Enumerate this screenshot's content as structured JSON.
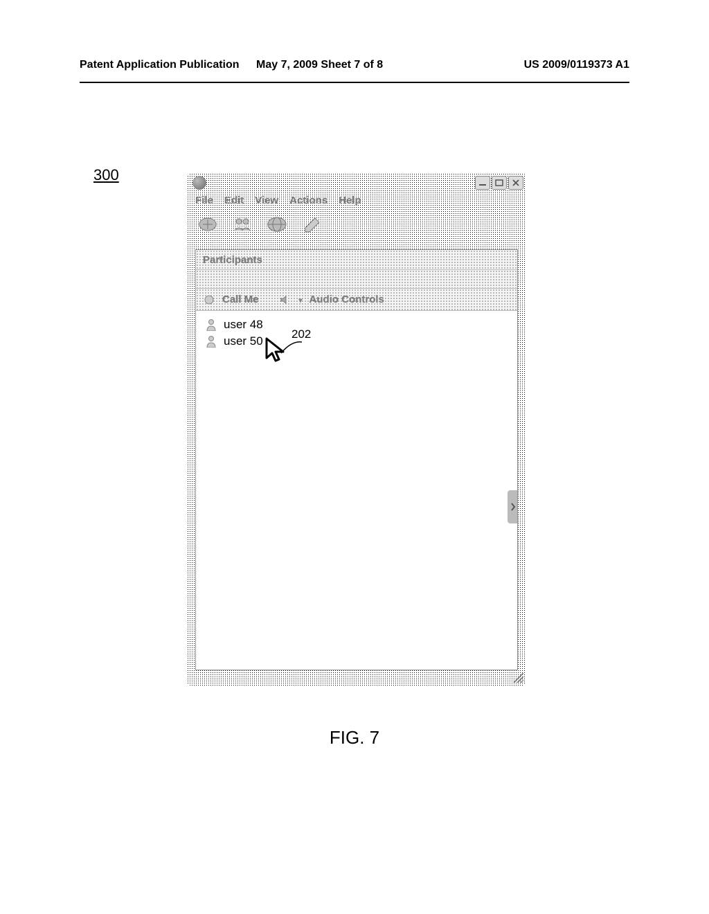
{
  "header": {
    "left": "Patent Application Publication",
    "mid": "May 7, 2009  Sheet 7 of 8",
    "right": "US 2009/0119373 A1"
  },
  "figure_number": "300",
  "figure_caption": "FIG. 7",
  "window": {
    "menu": [
      "File",
      "Edit",
      "View",
      "Actions",
      "Help"
    ],
    "section_title": "Participants",
    "call_me": "Call Me",
    "audio_controls": "Audio Controls",
    "participants": [
      "user 48",
      "user 50"
    ]
  },
  "annotation": {
    "cursor_ref": "202"
  }
}
